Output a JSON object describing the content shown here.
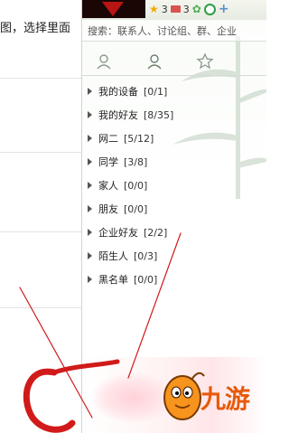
{
  "doc": {
    "line": "图，选择里面"
  },
  "panel": {
    "status_count_1": "3",
    "status_count_2": "3",
    "search_placeholder": "搜索：联系人、讨论组、群、企业"
  },
  "groups": [
    {
      "name": "我的设备",
      "count": "[0/1]"
    },
    {
      "name": "我的好友",
      "count": "[8/35]"
    },
    {
      "name": "网二",
      "count": "[5/12]"
    },
    {
      "name": "同学",
      "count": "[3/8]"
    },
    {
      "name": "家人",
      "count": "[0/0]"
    },
    {
      "name": "朋友",
      "count": "[0/0]"
    },
    {
      "name": "企业好友",
      "count": "[2/2]"
    },
    {
      "name": "陌生人",
      "count": "[0/3]"
    },
    {
      "name": "黑名单",
      "count": "[0/0]"
    }
  ],
  "watermark": {
    "text": "九游"
  },
  "colors": {
    "annotation_red": "#d11a1a",
    "watermark_orange": "#e65a0a"
  }
}
